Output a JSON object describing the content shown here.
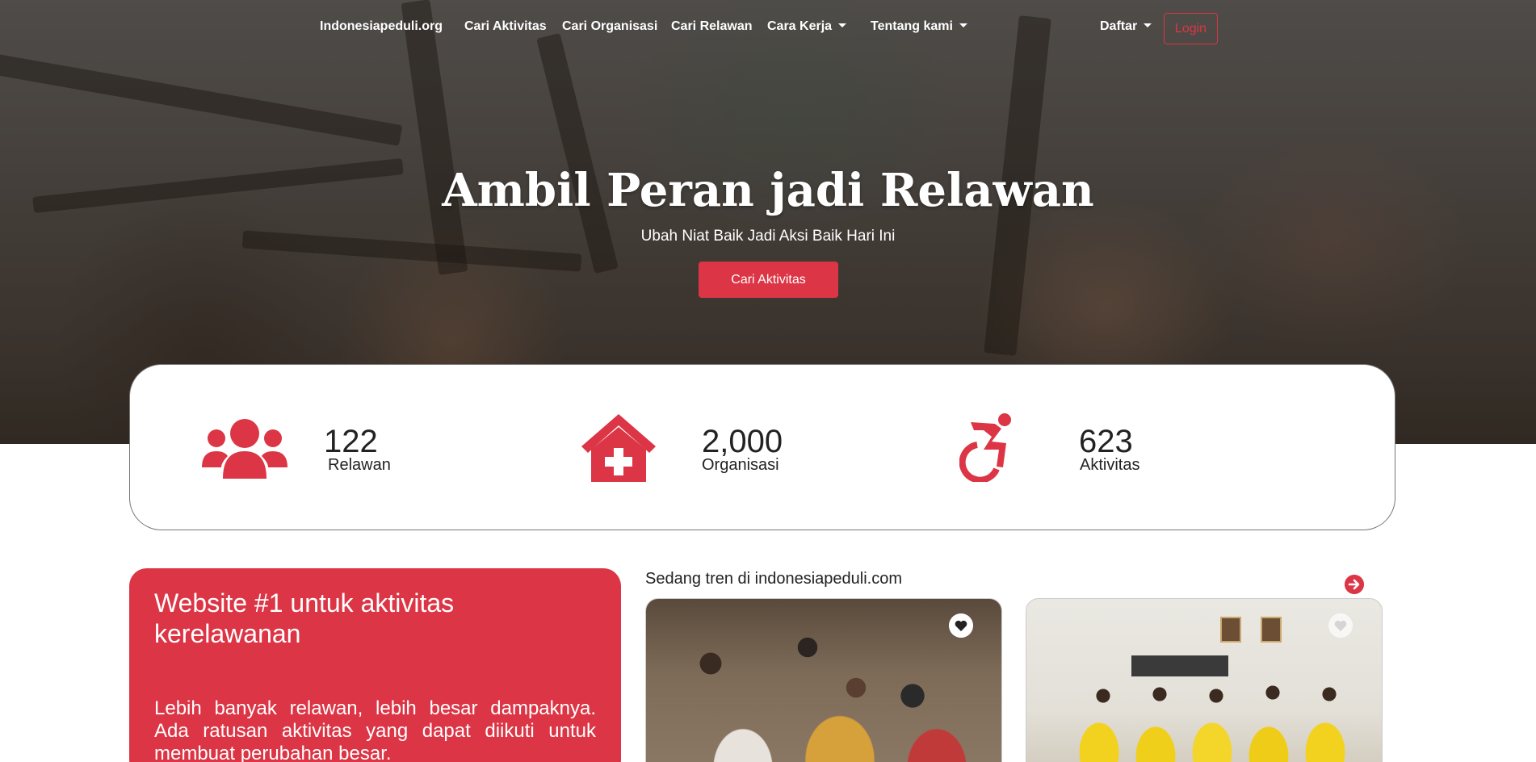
{
  "colors": {
    "accent": "#dc3545",
    "text": "#222222",
    "white": "#ffffff"
  },
  "nav": {
    "brand": "Indonesiapeduli.org",
    "links": [
      "Cari Aktivitas",
      "Cari Organisasi",
      "Cari Relawan"
    ],
    "dropdowns": [
      "Cara Kerja",
      "Tentang kami"
    ],
    "daftar": "Daftar",
    "login": "Login"
  },
  "hero": {
    "title": "Ambil Peran jadi Relawan",
    "subtitle": "Ubah Niat Baik Jadi Aksi Baik Hari Ini",
    "cta": "Cari Aktivitas"
  },
  "stats": [
    {
      "icon": "users-icon",
      "value": "122",
      "label": "Relawan"
    },
    {
      "icon": "clinic-house-icon",
      "value": "2,000",
      "label": "Organisasi"
    },
    {
      "icon": "wheelchair-icon",
      "value": "623",
      "label": "Aktivitas"
    }
  ],
  "promo": {
    "title": "Website #1 untuk aktivitas kerelawanan",
    "text": "Lebih banyak relawan, lebih besar dampaknya. Ada ratusan aktivitas yang dapat diikuti untuk membuat perubahan besar."
  },
  "trending": {
    "title": "Sedang tren di indonesiapeduli.com",
    "next_icon": "arrow-right-circle-icon",
    "cards": [
      {
        "favorite_icon": "heart-icon"
      },
      {
        "favorite_icon": "heart-icon"
      }
    ]
  }
}
